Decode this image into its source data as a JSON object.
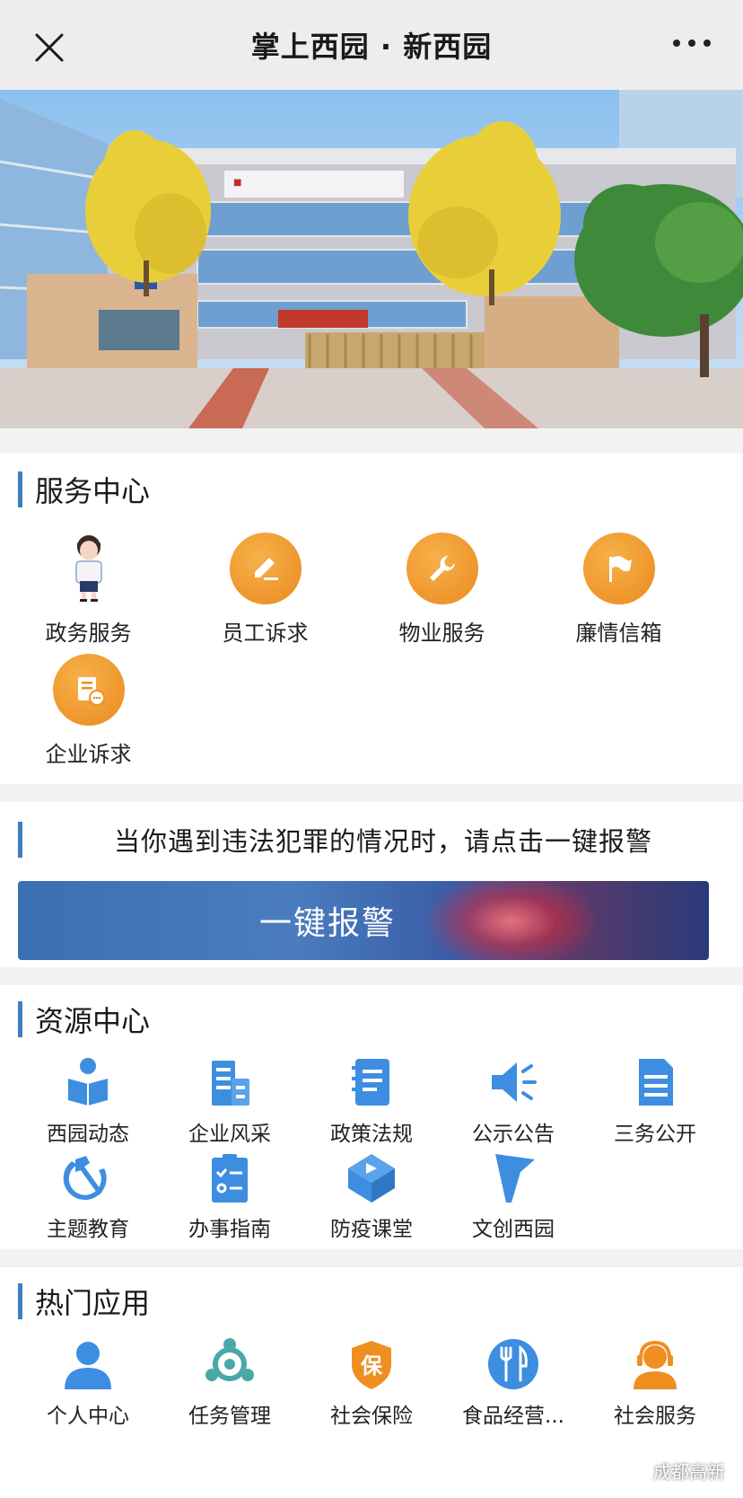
{
  "navbar": {
    "title": "掌上西园 · 新西园"
  },
  "services": {
    "title": "服务中心",
    "items": [
      {
        "label": "政务服务",
        "icon": "service-avatar-icon"
      },
      {
        "label": "员工诉求",
        "icon": "pencil-icon"
      },
      {
        "label": "物业服务",
        "icon": "wrench-icon"
      },
      {
        "label": "廉情信箱",
        "icon": "flag-icon"
      },
      {
        "label": "企业诉求",
        "icon": "document-chat-icon"
      }
    ],
    "accent": "#ef8f22"
  },
  "alarm": {
    "prompt": "当你遇到违法犯罪的情况时，请点击一键报警",
    "button_label": "一键报警"
  },
  "resources": {
    "title": "资源中心",
    "items": [
      {
        "label": "西园动态",
        "icon": "reader-icon"
      },
      {
        "label": "企业风采",
        "icon": "building-icon"
      },
      {
        "label": "政策法规",
        "icon": "notebook-icon"
      },
      {
        "label": "公示公告",
        "icon": "megaphone-icon"
      },
      {
        "label": "三务公开",
        "icon": "document-icon"
      },
      {
        "label": "主题教育",
        "icon": "hammer-sickle-icon"
      },
      {
        "label": "办事指南",
        "icon": "checklist-icon"
      },
      {
        "label": "防疫课堂",
        "icon": "play-cube-icon"
      },
      {
        "label": "文创西园",
        "icon": "pennant-icon"
      }
    ],
    "accent": "#3d8ee0"
  },
  "hot_apps": {
    "title": "热门应用",
    "items": [
      {
        "label": "个人中心",
        "icon": "person-icon"
      },
      {
        "label": "任务管理",
        "icon": "team-icon"
      },
      {
        "label": "社会保险",
        "icon": "insurance-shield-icon",
        "badge": "保"
      },
      {
        "label": "食品经营...",
        "icon": "fork-knife-icon"
      },
      {
        "label": "社会服务",
        "icon": "support-agent-icon"
      }
    ]
  },
  "watermark": {
    "text": "成都高新"
  },
  "colors": {
    "section_bar": "#3f7fc1",
    "nav_bg": "#ededed",
    "page_bg": "#f2f2f2"
  }
}
